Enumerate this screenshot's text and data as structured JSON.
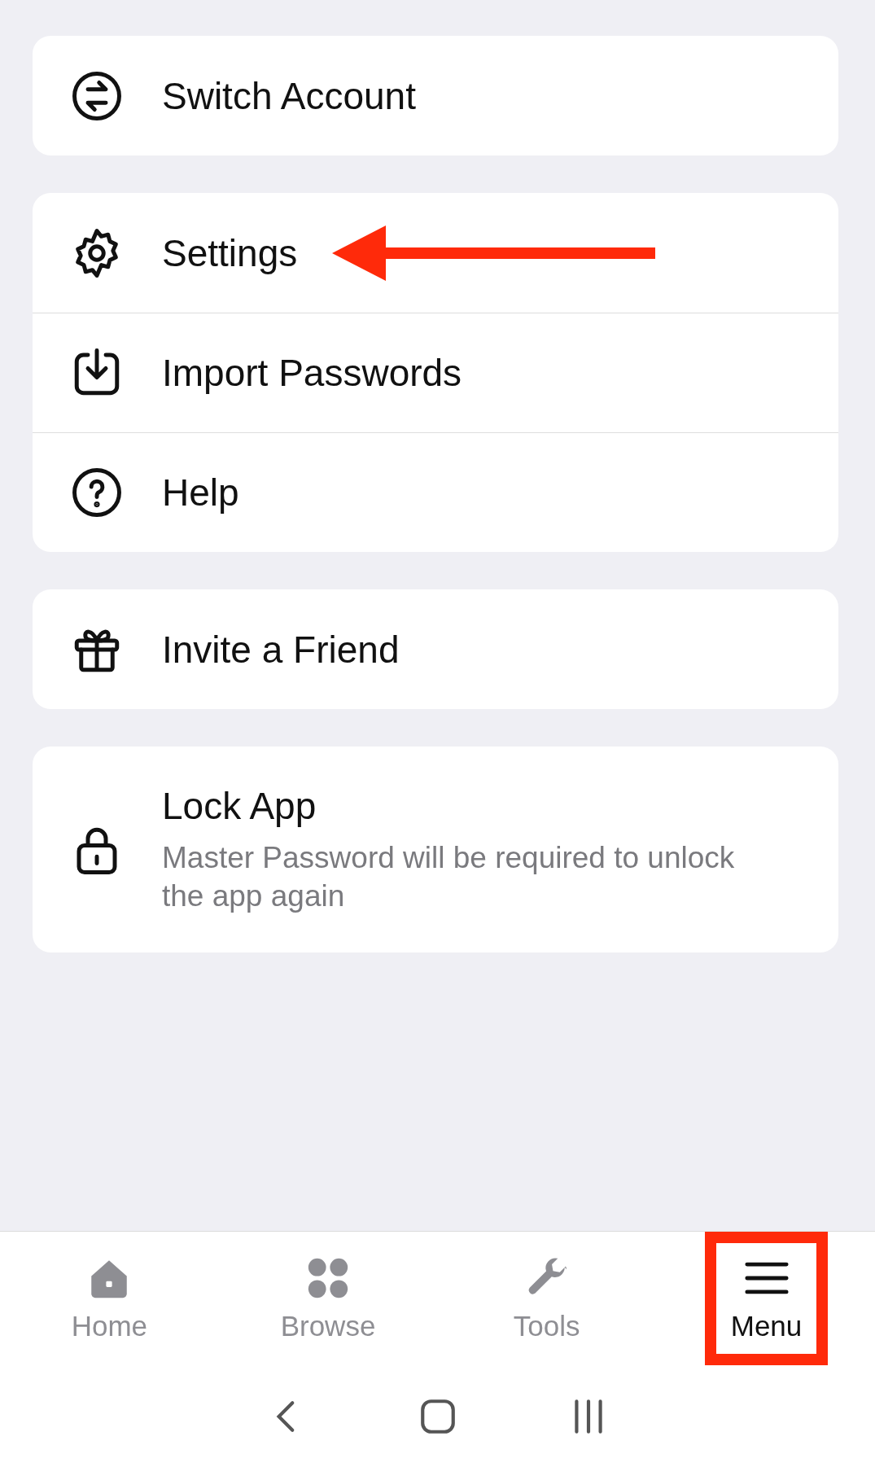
{
  "groups": [
    {
      "items": [
        {
          "kind": "switch",
          "label": "Switch Account",
          "arrow": false
        }
      ]
    },
    {
      "items": [
        {
          "kind": "gear",
          "label": "Settings",
          "arrow": true
        },
        {
          "kind": "import",
          "label": "Import Passwords",
          "arrow": false
        },
        {
          "kind": "help",
          "label": "Help",
          "arrow": false
        }
      ]
    },
    {
      "items": [
        {
          "kind": "gift",
          "label": "Invite a Friend",
          "arrow": false
        }
      ]
    },
    {
      "items": [
        {
          "kind": "lock",
          "label": "Lock App",
          "subtitle": "Master Password will be required to unlock the app again",
          "arrow": false
        }
      ]
    }
  ],
  "tab_bar": [
    {
      "kind": "home",
      "label": "Home",
      "selected": false,
      "highlighted": false
    },
    {
      "kind": "browse",
      "label": "Browse",
      "selected": false,
      "highlighted": false
    },
    {
      "kind": "tools",
      "label": "Tools",
      "selected": false,
      "highlighted": false
    },
    {
      "kind": "menu",
      "label": "Menu",
      "selected": true,
      "highlighted": true
    }
  ]
}
